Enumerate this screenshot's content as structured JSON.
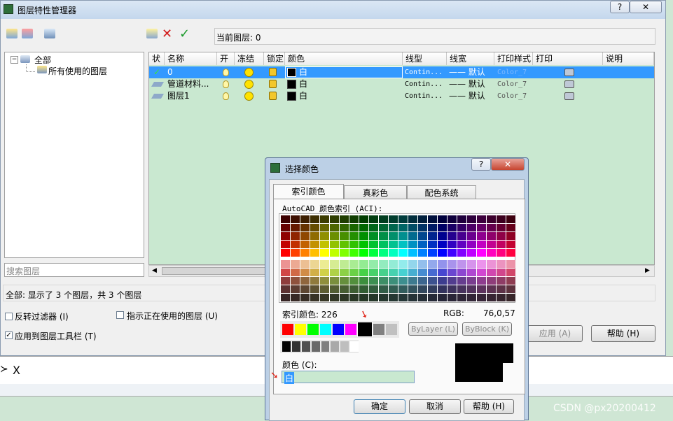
{
  "main_window": {
    "title": "图层特性管理器",
    "help_glyph": "?",
    "close_glyph": "✕",
    "current_layer_label": "当前图层: 0",
    "tree": {
      "root": "全部",
      "child": "所有使用的图层"
    },
    "search_placeholder": "搜索图层",
    "status_text": "全部: 显示了 3 个图层，共 3 个图层",
    "columns": [
      "状",
      "名称",
      "开",
      "冻结",
      "锁定",
      "颜色",
      "线型",
      "线宽",
      "打印样式",
      "打印",
      "说明"
    ],
    "rows": [
      {
        "status": "✓",
        "name": "0",
        "color": "白",
        "linetype": "Contin...",
        "lineweight": "—— 默认",
        "plotstyle": "Color_7"
      },
      {
        "status": "",
        "name": "管道材料...",
        "color": "白",
        "linetype": "Contin...",
        "lineweight": "—— 默认",
        "plotstyle": "Color_7"
      },
      {
        "status": "",
        "name": "图层1",
        "color": "白",
        "linetype": "Contin...",
        "lineweight": "—— 默认",
        "plotstyle": "Color_7"
      }
    ],
    "options": {
      "invert_filter": "反转过滤器 (I)",
      "show_in_use": "指示正在使用的图层 (U)",
      "apply_toolbar": "应用到图层工具栏 (T)"
    },
    "apply_button": "应用 (A)",
    "help_button": "帮助 (H)",
    "command_glyphs": [
      "≻",
      "X"
    ]
  },
  "color_dialog": {
    "title": "选择颜色",
    "help_glyph": "?",
    "close_glyph": "✕",
    "tabs": [
      "索引颜色",
      "真彩色",
      "配色系统"
    ],
    "aci_label": "AutoCAD 颜色索引 (ACI):",
    "index_label": "索引颜色: 226",
    "rgb_label": "RGB:",
    "rgb_value": "76,0,57",
    "bylayer_button": "ByLayer (L)",
    "byblock_button": "ByBlock (K)",
    "color_field_label": "颜色 (C):",
    "color_field_value": "白",
    "ok_button": "确定",
    "cancel_button": "取消",
    "help_button": "帮助 (H)",
    "standard_colors": [
      "#ff0000",
      "#ffff00",
      "#00ff00",
      "#00ffff",
      "#0000ff",
      "#ff00ff",
      "#000000",
      "#808080",
      "#c0c0c0"
    ],
    "gray_colors": [
      "#000000",
      "#333333",
      "#505050",
      "#696969",
      "#808080",
      "#a9a9a9",
      "#bebebe",
      "#ffffff"
    ],
    "preview_color": "#000000"
  },
  "watermark": "CSDN @px20200412",
  "accent_colors": {
    "selection": "#3399ff",
    "panel_green": "#c9e8d0"
  }
}
